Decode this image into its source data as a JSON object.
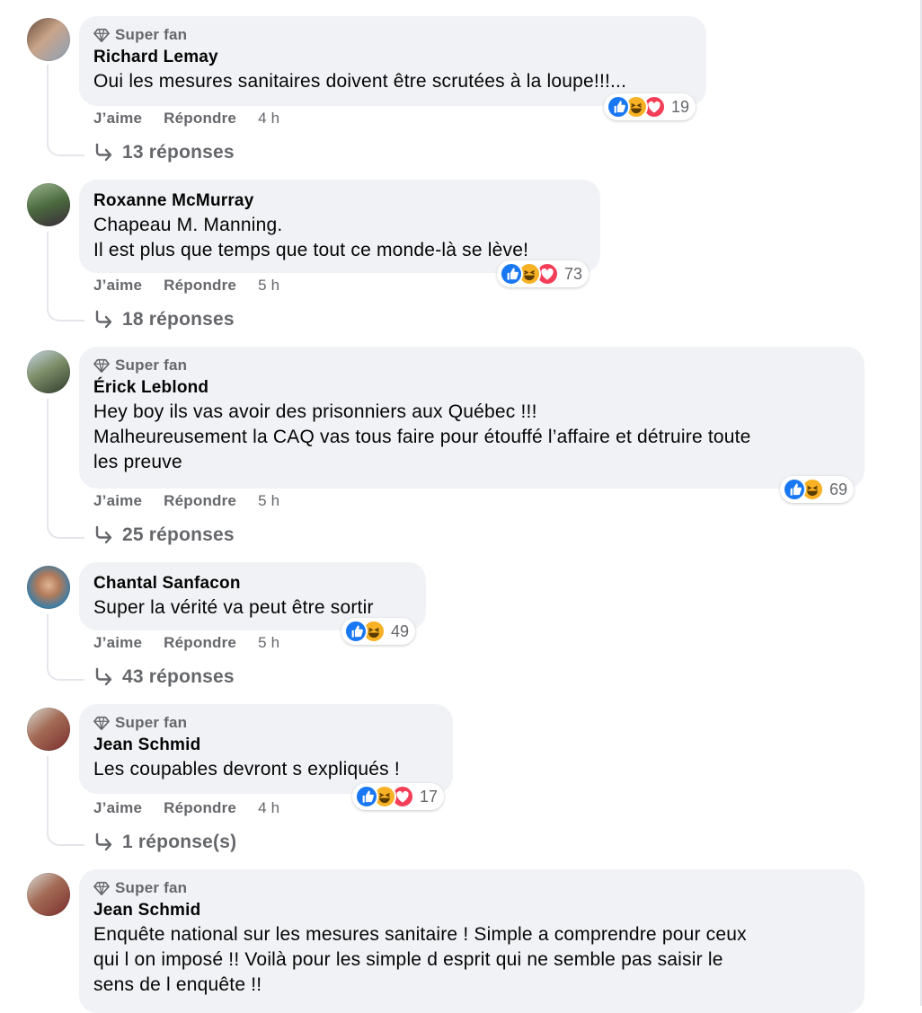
{
  "labels": {
    "like": "J’aime",
    "reply": "Répondre"
  },
  "comments": [
    {
      "badge": "Super fan",
      "author": "Richard Lemay",
      "text": "Oui les mesures sanitaires doivent être scrutées à la loupe!!!...",
      "time": "4 h",
      "reaction_count": "19",
      "replies": "13 réponses",
      "reactions": [
        "like",
        "haha",
        "love"
      ]
    },
    {
      "badge": "",
      "author": "Roxanne McMurray",
      "text": "Chapeau M. Manning.\nIl est plus que temps que tout ce monde-là se lève!",
      "time": "5 h",
      "reaction_count": "73",
      "replies": "18 réponses",
      "reactions": [
        "like",
        "haha",
        "love"
      ]
    },
    {
      "badge": "Super fan",
      "author": "Érick Leblond",
      "text": "Hey boy ils vas avoir des prisonniers aux Québec !!!\nMalheureusement la CAQ vas tous faire pour étouffé l’affaire et détruire toute\nles preuve",
      "time": "5 h",
      "reaction_count": "69",
      "replies": "25 réponses",
      "reactions": [
        "like",
        "haha"
      ]
    },
    {
      "badge": "",
      "author": "Chantal Sanfacon",
      "text": "Super la vérité va peut être sortir",
      "time": "5 h",
      "reaction_count": "49",
      "replies": "43 réponses",
      "reactions": [
        "like",
        "haha"
      ]
    },
    {
      "badge": "Super fan",
      "author": "Jean Schmid",
      "text": "Les coupables devront s expliqués !",
      "time": "4 h",
      "reaction_count": "17",
      "replies": "1 réponse(s)",
      "reactions": [
        "like",
        "haha",
        "love"
      ]
    },
    {
      "badge": "Super fan",
      "author": "Jean Schmid",
      "text": "Enquête national sur les mesures sanitaire ! Simple a comprendre pour ceux\nqui l on imposé !! Voilà pour les simple d esprit qui ne semble pas saisir le\nsens de l enquête !!"
    }
  ],
  "colors": {
    "like": "#1877f2",
    "haha": "#f7b125",
    "love": "#f33e58",
    "bubble": "#f0f2f5",
    "secondary_text": "#65676b"
  }
}
